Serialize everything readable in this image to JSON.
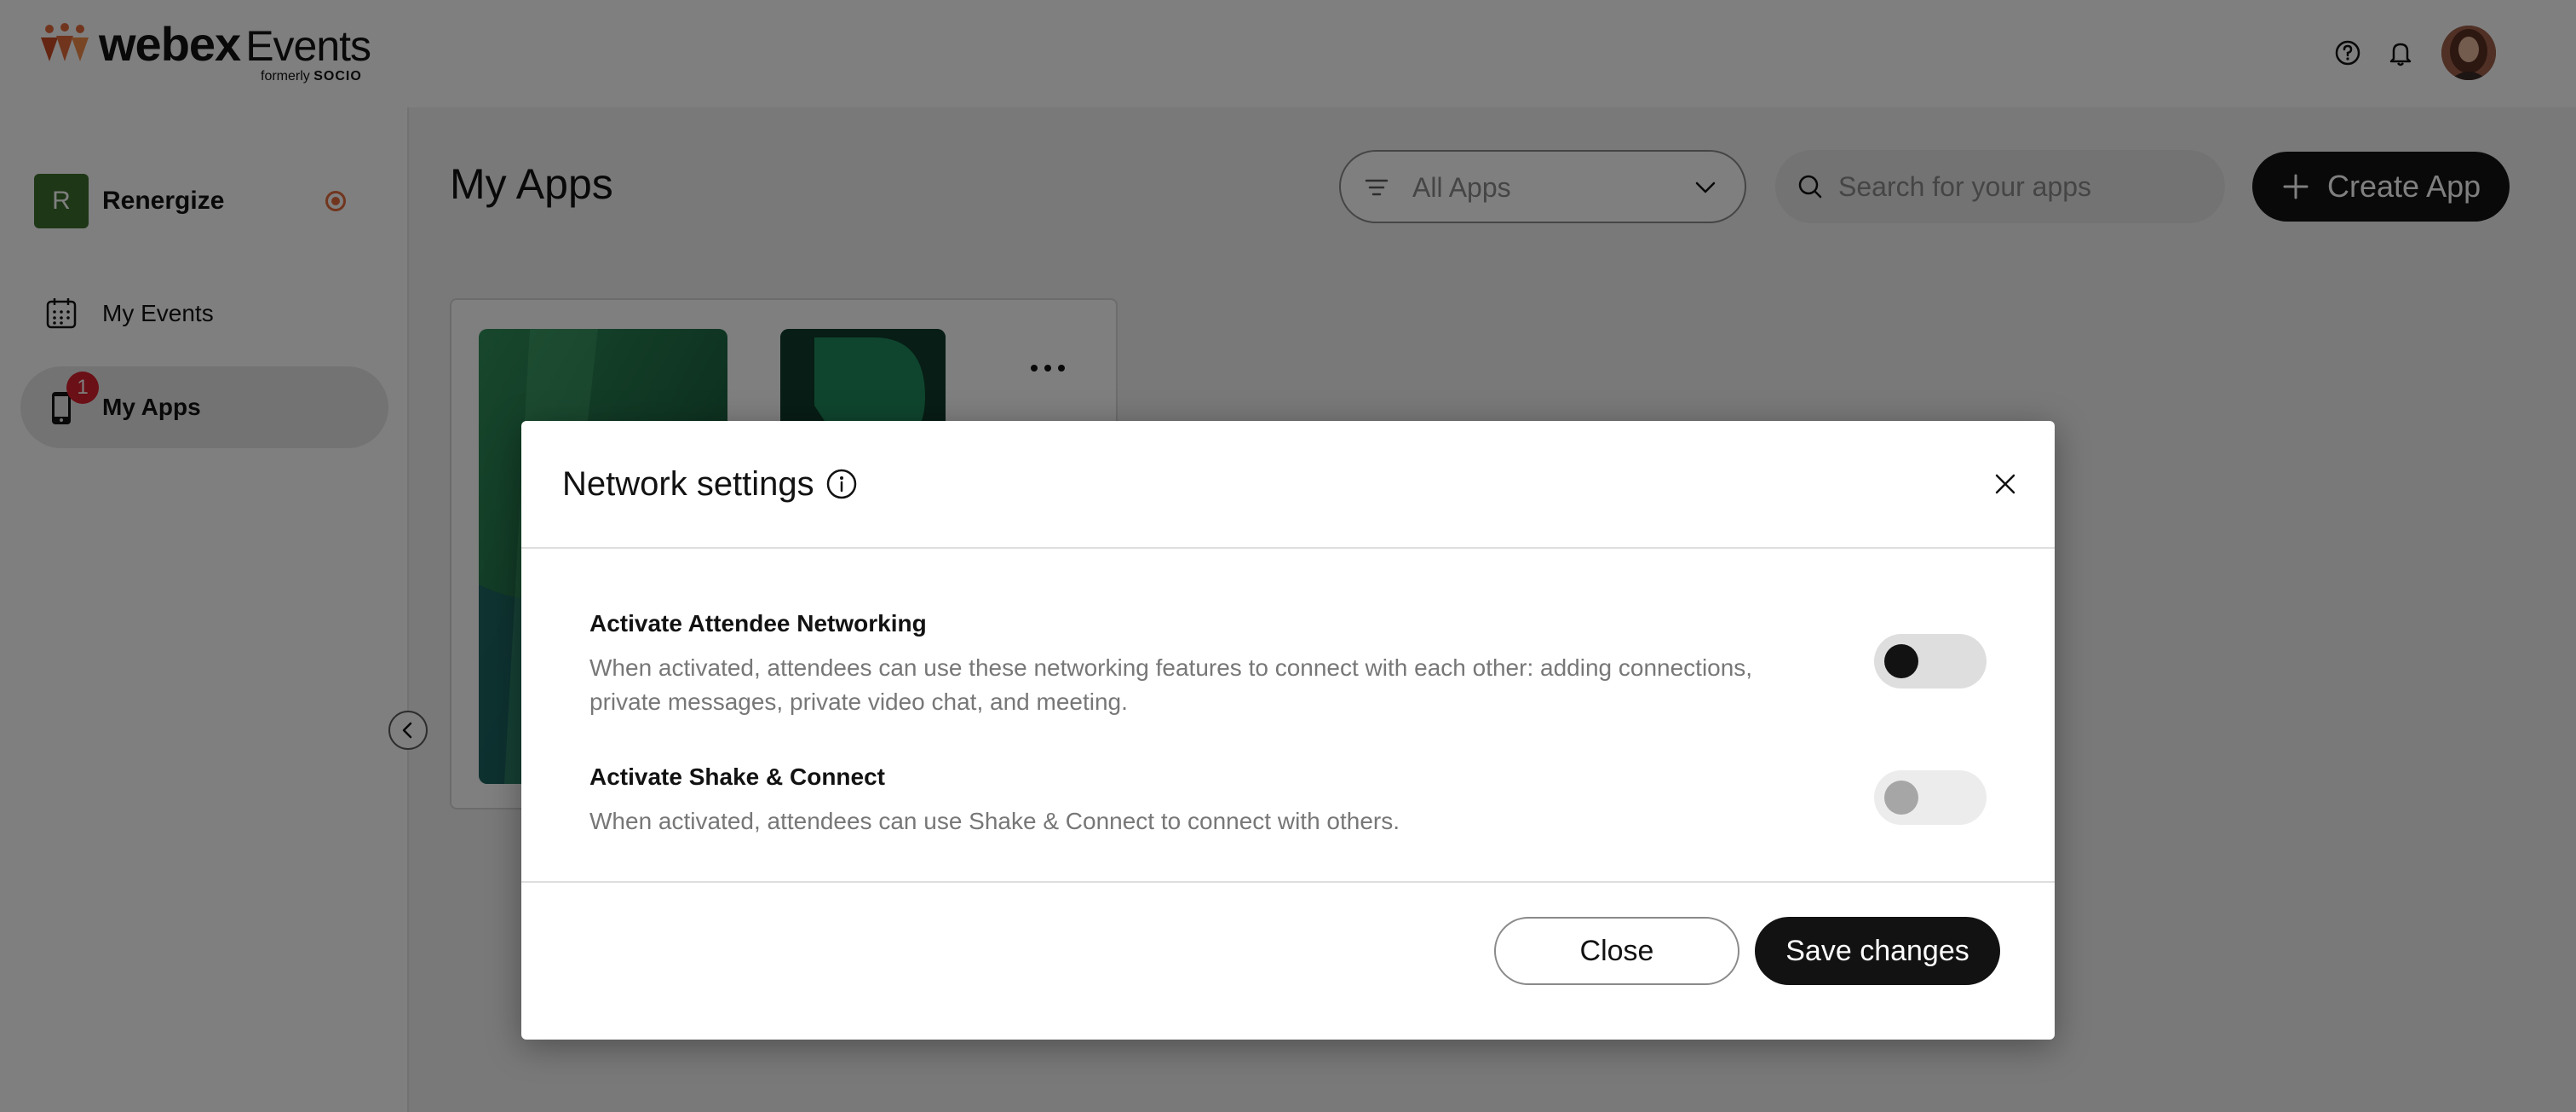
{
  "brand": {
    "name": "webex",
    "events": "Events",
    "formerly": "formerly",
    "formerly_brand": "SOCIO"
  },
  "header": {
    "help_icon": "help-circle-icon",
    "bell_icon": "bell-icon",
    "avatar_icon": "user-avatar"
  },
  "sidebar": {
    "org_initial": "R",
    "org_name": "Renergize",
    "items": [
      {
        "label": "My Events",
        "icon": "calendar-icon"
      },
      {
        "label": "My Apps",
        "icon": "phone-icon",
        "badge": "1"
      }
    ]
  },
  "main": {
    "title": "My Apps",
    "filter_value": "All Apps",
    "search_placeholder": "Search for your apps",
    "create_label": "Create App"
  },
  "dialog": {
    "title": "Network settings",
    "settings": [
      {
        "title": "Activate Attendee Networking",
        "description": "When activated, attendees can use these networking features to connect with each other: adding connections, private messages, private video chat, and meeting."
      },
      {
        "title": "Activate Shake & Connect",
        "description": "When activated, attendees can use Shake & Connect to connect with others."
      }
    ],
    "close_label": "Close",
    "save_label": "Save changes"
  },
  "colors": {
    "accent": "#121212",
    "org_badge": "#3c6e2c",
    "notification_badge": "#d4202c",
    "status_ring": "#e36a3c"
  }
}
